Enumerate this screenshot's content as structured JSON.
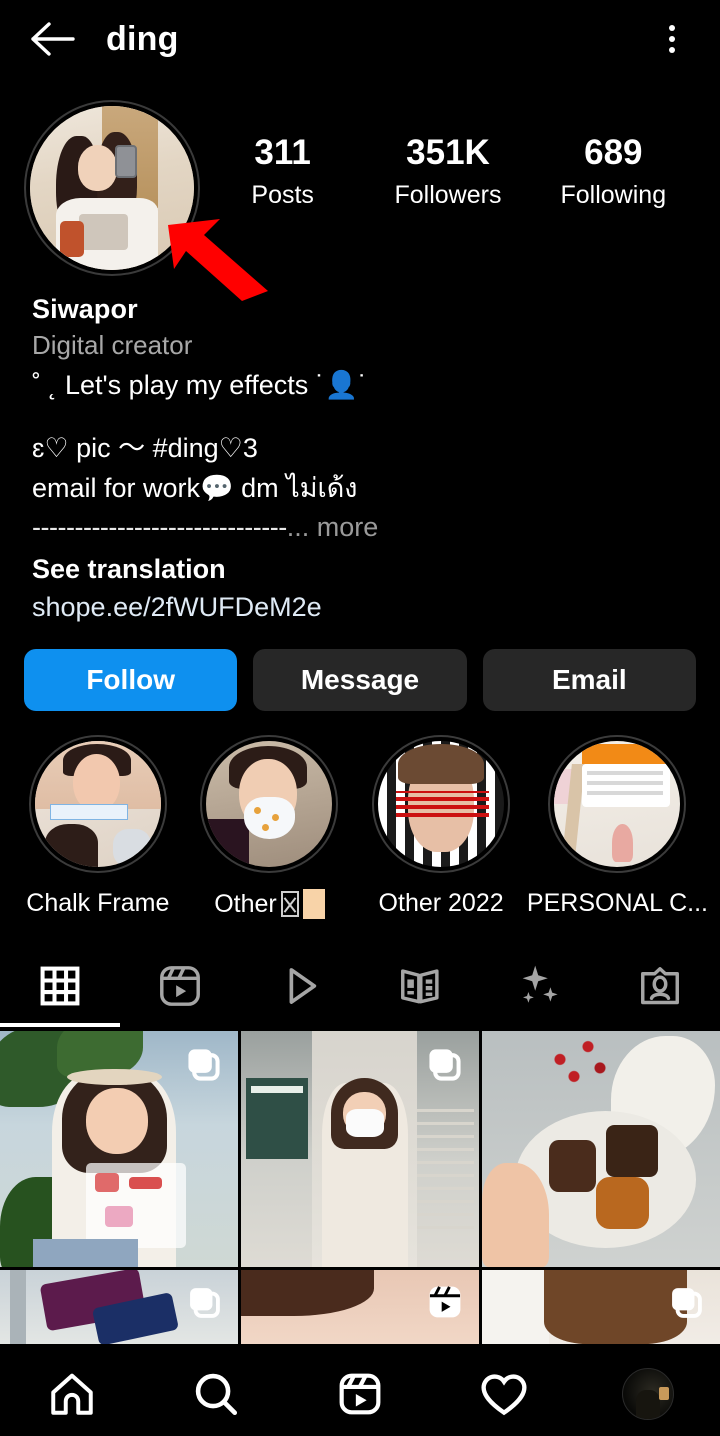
{
  "header": {
    "title": "ding",
    "back_icon": "back-arrow-icon",
    "menu_icon": "more-options-icon"
  },
  "profile": {
    "avatar_alt": "profile-picture",
    "annotation_arrow": "red-pointer-arrow",
    "stats": [
      {
        "value": "311",
        "label": "Posts"
      },
      {
        "value": "351K",
        "label": "Followers"
      },
      {
        "value": "689",
        "label": "Following"
      }
    ],
    "display_name": "Siwapor",
    "category": "Digital creator",
    "bio_line1": "˚ ˛ Let's play my effects ˙👤˙",
    "bio_line2": "ɛ♡ pic 〜 #ding♡3",
    "bio_line3": "email for work💬 dm ไม่เด้ง",
    "bio_dashes": "------------------------------",
    "more_label": "... more",
    "see_translation": "See translation",
    "link": "shope.ee/2fWUFDeM2e"
  },
  "actions": {
    "follow": "Follow",
    "message": "Message",
    "email": "Email",
    "follow_color": "#0e90ef",
    "secondary_color": "#272727"
  },
  "highlights": [
    {
      "label": "Chalk Frame",
      "has_peach_box": false
    },
    {
      "label": "Other ",
      "has_peach_box": true
    },
    {
      "label": "Other 2022",
      "has_peach_box": false
    },
    {
      "label": "PERSONAL C...",
      "has_peach_box": false
    }
  ],
  "tabs": [
    {
      "name": "grid-tab",
      "icon": "grid-icon",
      "active": true
    },
    {
      "name": "reels-tab",
      "icon": "reels-icon",
      "active": false
    },
    {
      "name": "igtv-tab",
      "icon": "play-icon",
      "active": false
    },
    {
      "name": "guides-tab",
      "icon": "guides-icon",
      "active": false
    },
    {
      "name": "effects-tab",
      "icon": "sparkles-icon",
      "active": false
    },
    {
      "name": "tagged-tab",
      "icon": "tagged-person-icon",
      "active": false
    }
  ],
  "grid": {
    "row1": [
      {
        "type": "carousel",
        "overlay_icon": "carousel-icon"
      },
      {
        "type": "carousel",
        "overlay_icon": "carousel-icon"
      },
      {
        "type": "photo",
        "overlay_icon": ""
      }
    ],
    "row2": [
      {
        "type": "carousel",
        "overlay_icon": "carousel-icon"
      },
      {
        "type": "reel",
        "overlay_icon": "reels-icon"
      },
      {
        "type": "carousel",
        "overlay_icon": "carousel-icon"
      }
    ]
  },
  "bottom_nav": [
    {
      "name": "home-nav",
      "icon": "home-icon"
    },
    {
      "name": "search-nav",
      "icon": "search-icon"
    },
    {
      "name": "reels-nav",
      "icon": "reels-icon"
    },
    {
      "name": "activity-nav",
      "icon": "heart-icon"
    },
    {
      "name": "profile-nav",
      "icon": "profile-avatar"
    }
  ]
}
